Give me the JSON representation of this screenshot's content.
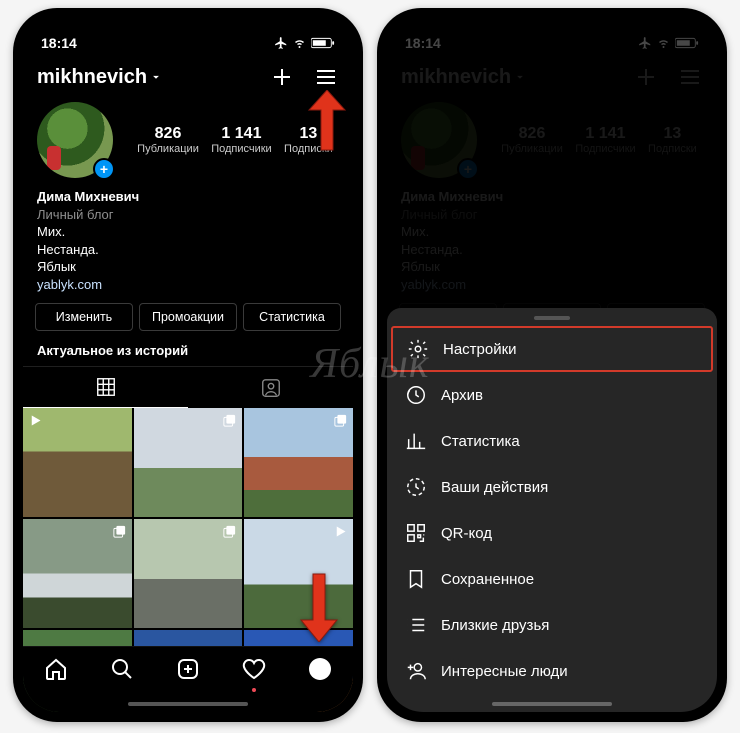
{
  "status": {
    "time": "18:14"
  },
  "header": {
    "username": "mikhnevich"
  },
  "stats": {
    "posts": {
      "num": "826",
      "label": "Публикации"
    },
    "followers": {
      "num": "1 141",
      "label": "Подписчики"
    },
    "following": {
      "num": "13",
      "label": "Подписки"
    }
  },
  "bio": {
    "name": "Дима Михневич",
    "category": "Личный блог",
    "line1": "Мих.",
    "line2": "Нестанда.",
    "line3": "Яблык",
    "link": "yablyk.com"
  },
  "buttons": {
    "edit": "Изменить",
    "promo": "Промоакции",
    "stats": "Статистика"
  },
  "highlights_title": "Актуальное из историй",
  "menu": {
    "settings": "Настройки",
    "archive": "Архив",
    "insights": "Статистика",
    "activity": "Ваши действия",
    "qr": "QR-код",
    "saved": "Сохраненное",
    "close_friends": "Близкие друзья",
    "discover": "Интересные люди"
  },
  "watermark": "Яблык"
}
